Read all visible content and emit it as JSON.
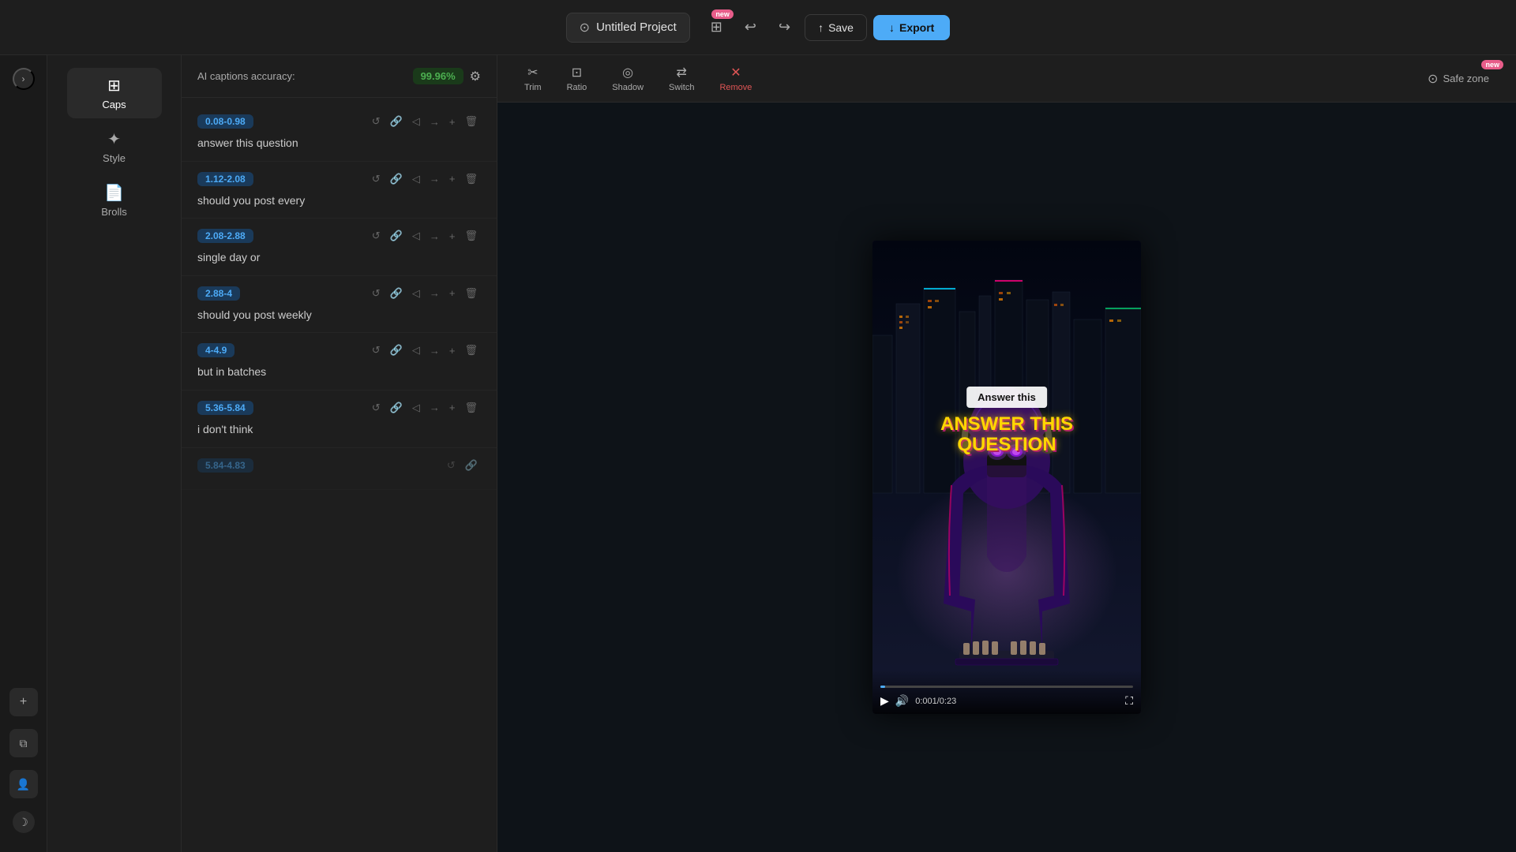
{
  "topbar": {
    "project_title": "Untitled Project",
    "new_label": "new",
    "save_label": "Save",
    "export_label": "Export",
    "undo_title": "Undo",
    "redo_title": "Redo"
  },
  "far_sidebar": {
    "collapse_icon": "›",
    "add_icon": "+",
    "history_icon": "⧉",
    "user_icon": "👤",
    "moon_icon": "☽"
  },
  "left_sidebar": {
    "items": [
      {
        "id": "caps",
        "label": "Caps",
        "icon": "⊞",
        "active": true
      },
      {
        "id": "style",
        "label": "Style",
        "icon": "✦"
      },
      {
        "id": "brolls",
        "label": "Brolls",
        "icon": "📄"
      }
    ]
  },
  "caption_panel": {
    "header_label": "AI captions accuracy:",
    "accuracy": "99.96%",
    "captions": [
      {
        "time": "0.08-0.98",
        "text": "answer this question",
        "color": "blue"
      },
      {
        "time": "1.12-2.08",
        "text": "should you post every",
        "color": "blue"
      },
      {
        "time": "2.08-2.88",
        "text": "single day or",
        "color": "blue"
      },
      {
        "time": "2.88-4",
        "text": "should you post weekly",
        "color": "blue"
      },
      {
        "time": "4-4.9",
        "text": "but in batches",
        "color": "blue"
      },
      {
        "time": "5.36-5.84",
        "text": "i don't think",
        "color": "blue"
      }
    ]
  },
  "preview_toolbar": {
    "tools": [
      {
        "id": "trim",
        "label": "Trim",
        "icon": "✂"
      },
      {
        "id": "ratio",
        "label": "Ratio",
        "icon": "⊡"
      },
      {
        "id": "shadow",
        "label": "Shadow",
        "icon": "◎"
      },
      {
        "id": "switch",
        "label": "Switch",
        "icon": "⇄"
      },
      {
        "id": "remove",
        "label": "Remove",
        "icon": "✕"
      }
    ],
    "safezone_label": "Safe zone",
    "new_label": "new"
  },
  "video": {
    "caption_overlay": "Answer this",
    "main_text_line1": "ANSWER THIS",
    "main_text_line2": "QUESTION",
    "current_time": "0:001",
    "total_time": "0:23",
    "time_display": "0:001/0:23"
  }
}
